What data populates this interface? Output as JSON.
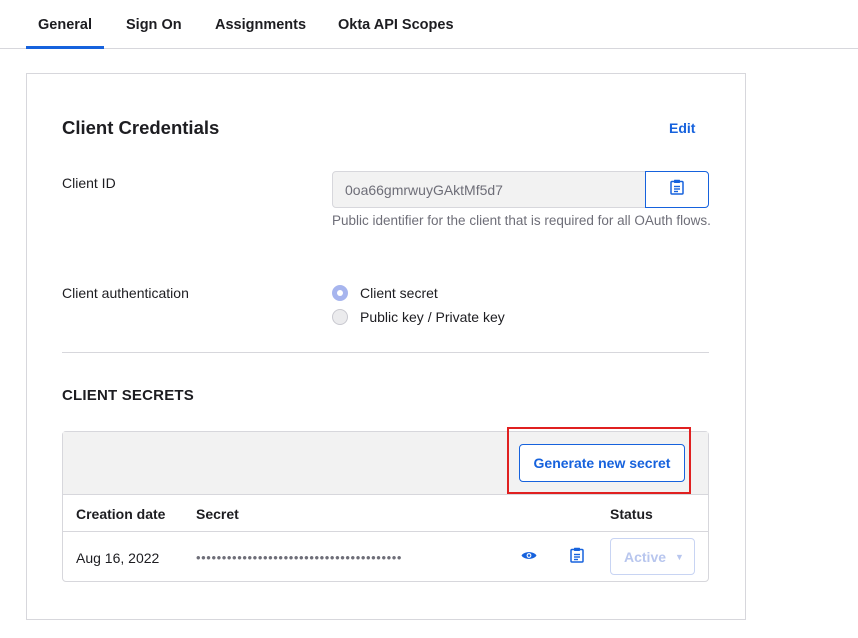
{
  "tabs": [
    {
      "label": "General",
      "active": true
    },
    {
      "label": "Sign On",
      "active": false
    },
    {
      "label": "Assignments",
      "active": false
    },
    {
      "label": "Okta API Scopes",
      "active": false
    }
  ],
  "credentials": {
    "title": "Client Credentials",
    "edit_label": "Edit",
    "client_id_label": "Client ID",
    "client_id_value": "0oa66gmrwuyGAktMf5d7",
    "client_id_helper": "Public identifier for the client that is required for all OAuth flows.",
    "copy_icon": "clipboard-icon",
    "auth_label": "Client authentication",
    "auth_options": [
      {
        "label": "Client secret",
        "selected": true
      },
      {
        "label": "Public key / Private key",
        "selected": false
      }
    ]
  },
  "client_secrets": {
    "title": "CLIENT SECRETS",
    "generate_label": "Generate new secret",
    "columns": [
      "Creation date",
      "Secret",
      "Status"
    ],
    "rows": [
      {
        "creation_date": "Aug 16, 2022",
        "secret_masked": "••••••••••••••••••••••••••••••••••••••••",
        "reveal_icon": "eye-icon",
        "copy_icon": "clipboard-icon",
        "status": "Active"
      }
    ]
  },
  "colors": {
    "accent": "#1662dd",
    "highlight": "#e02020"
  }
}
